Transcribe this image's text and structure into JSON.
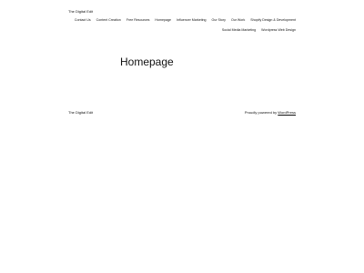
{
  "header": {
    "site_title": "The Digital Edit",
    "nav_row_1": [
      {
        "label": "Contact Us"
      },
      {
        "label": "Content Creation"
      },
      {
        "label": "Free Resources"
      },
      {
        "label": "Homepage"
      },
      {
        "label": "Influencer Marketing"
      },
      {
        "label": "Our Story"
      },
      {
        "label": "Our Work"
      },
      {
        "label": "Shopify Design & Development"
      }
    ],
    "nav_row_2": [
      {
        "label": "Social Media Marketing"
      },
      {
        "label": "Wordpress Web Design"
      }
    ]
  },
  "main": {
    "page_title": "Homepage"
  },
  "footer": {
    "site_title": "The Digital Edit",
    "credit_prefix": "Proudly powered by ",
    "credit_link": "WordPress"
  }
}
